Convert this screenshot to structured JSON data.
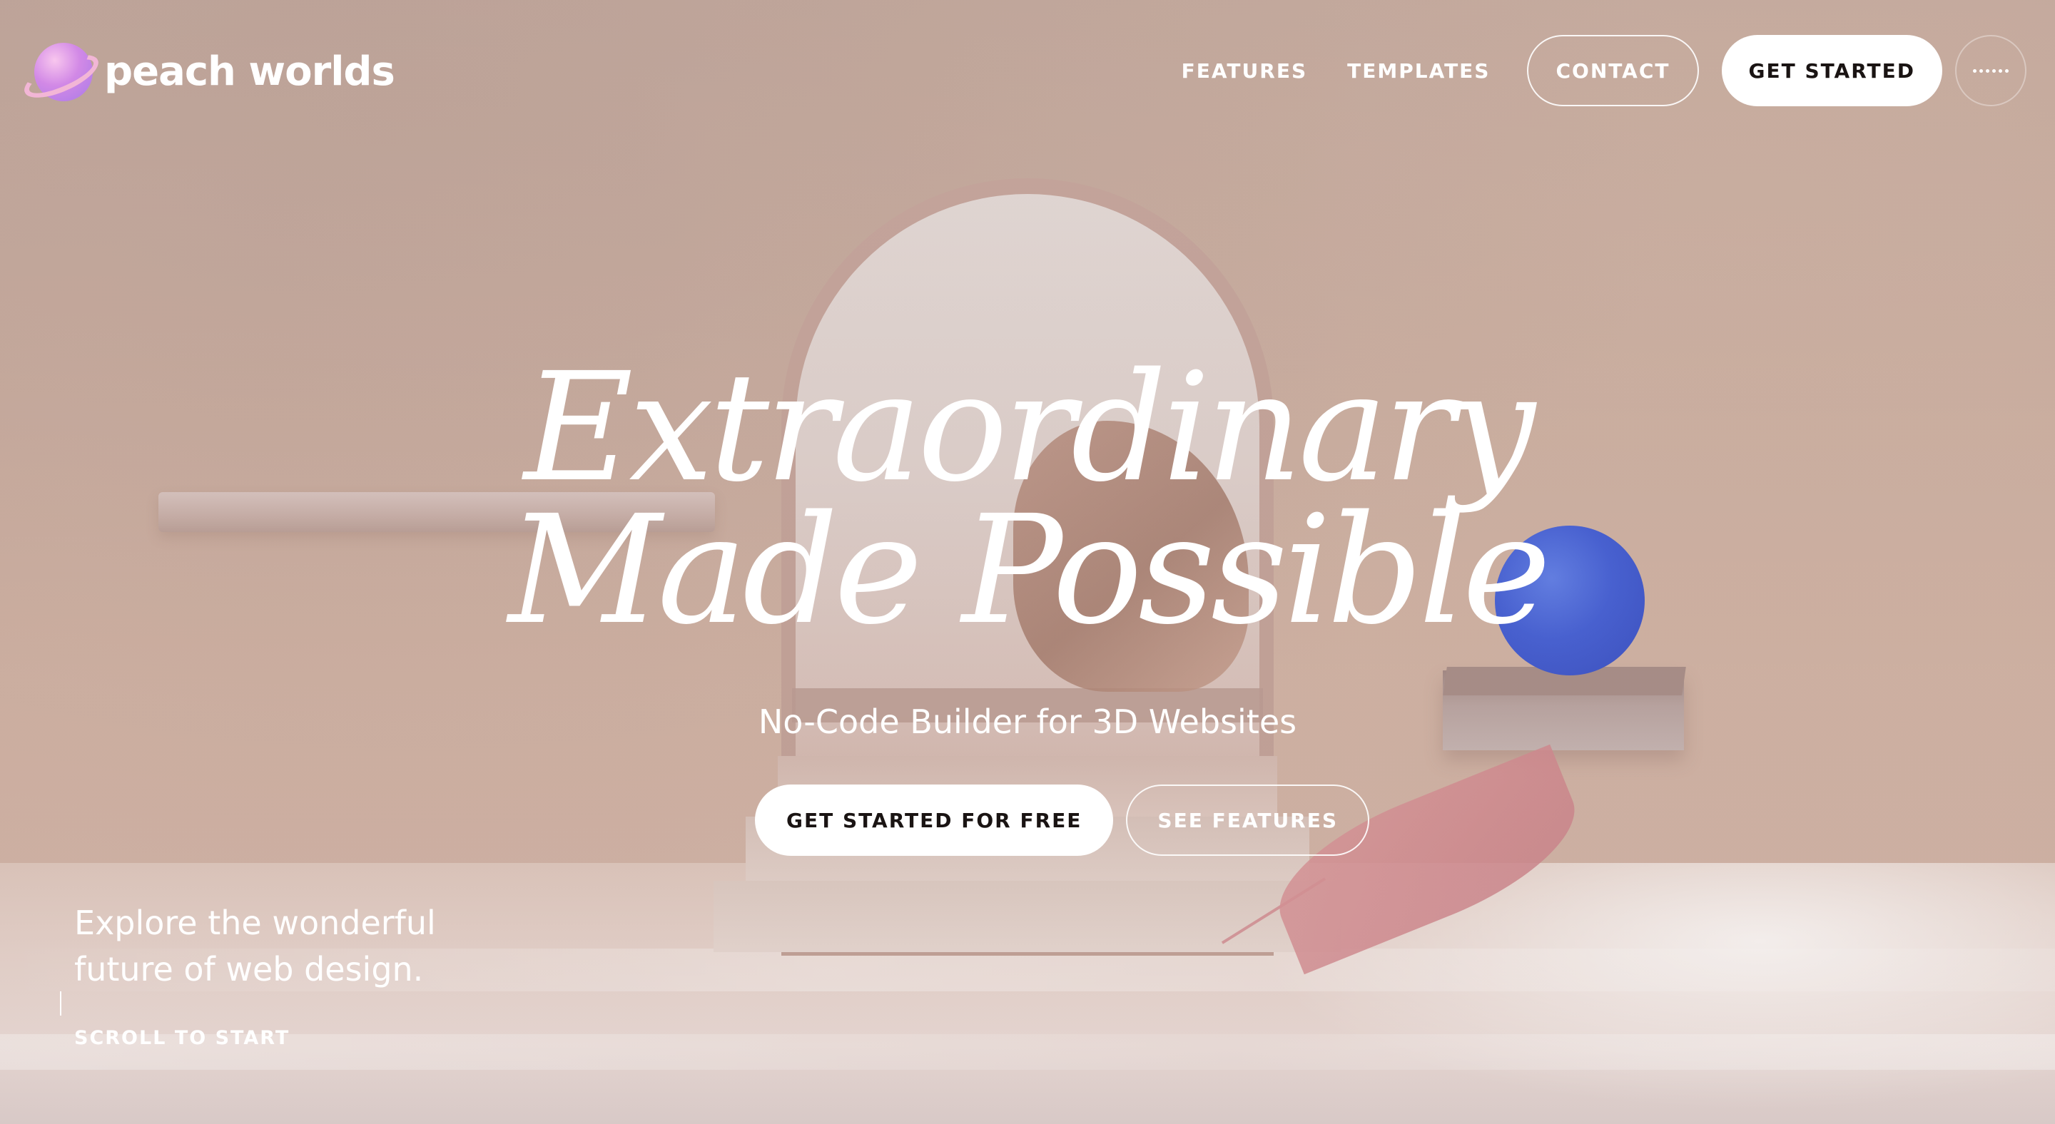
{
  "brand": {
    "name": "peach worlds"
  },
  "nav": {
    "features": "FEATURES",
    "templates": "TEMPLATES",
    "contact": "CONTACT",
    "get_started": "GET STARTED",
    "menu_icon": "dots-menu-icon"
  },
  "hero": {
    "title_line1": "Extraordinary",
    "title_line2": "Made Possible",
    "subtitle": "No-Code Builder for 3D Websites",
    "cta_primary": "GET STARTED FOR FREE",
    "cta_secondary": "SEE FEATURES"
  },
  "footer_left": {
    "tagline_line1": "Explore the wonderful",
    "tagline_line2": "future of web design.",
    "scroll_cta": "SCROLL TO START"
  },
  "colors": {
    "background": "#c9ada0",
    "button_fill": "#ffffff",
    "button_text": "#1a1413",
    "sphere_blue": "#3d5bd6",
    "leaf_pink": "#d0868d"
  }
}
